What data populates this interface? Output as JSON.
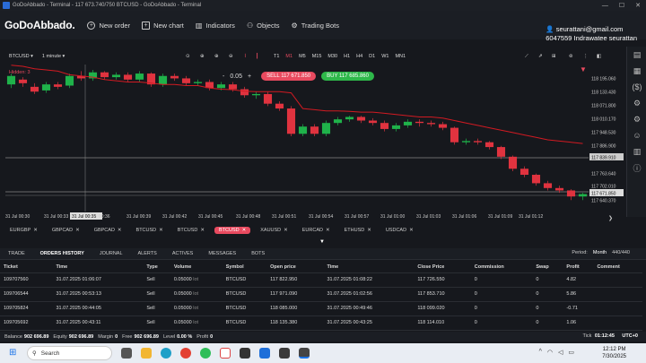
{
  "window": {
    "title": "GoDoAbbado - Terminal - 117 673.740/750 BTCUSD - GoDoAbbado - Terminal",
    "minimize": "—",
    "maximize": "☐",
    "close": "✕"
  },
  "toolbar": {
    "logo": "GoDoAbbado.",
    "new_order": "New order",
    "new_chart": "New chart",
    "indicators": "Indicators",
    "objects": "Objects",
    "trading_bots": "Trading Bots"
  },
  "account": {
    "email": "seurattani@gmail.com",
    "id_name": "6047559 Indrawatee seurattan"
  },
  "chart_toolbar": {
    "symbol": "BTCUSD",
    "timeframe": "1 minute",
    "timeframes": [
      "T1",
      "M1",
      "M5",
      "M15",
      "M30",
      "H1",
      "H4",
      "D1",
      "W1",
      "MN1"
    ],
    "active_tf": "M1"
  },
  "trade_widget": {
    "hidden_label": "Hidden: 3",
    "minus": "-",
    "lot": "0.05",
    "plus": "+",
    "sell_label": "SELL",
    "sell_price": "117 671.850",
    "buy_label": "BUY",
    "buy_price": "117 685.860"
  },
  "price_axis": [
    "118 195.060",
    "118 133.430",
    "118 071.800",
    "118 010.170",
    "117 948.530",
    "117 886.900",
    "117 839.910",
    "117 763.640",
    "117 702.010",
    "117 671.850",
    "117 640.370"
  ],
  "time_axis": [
    "31 Jul 00:30",
    "31 Jul 00:33",
    "31 Jul 00:35",
    "00:36",
    "31 Jul 00:39",
    "31 Jul 00:42",
    "31 Jul 00:45",
    "31 Jul 00:48",
    "31 Jul 00:51",
    "31 Jul 00:54",
    "31 Jul 00:57",
    "31 Jul 01:00",
    "31 Jul 01:03",
    "31 Jul 01:06",
    "31 Jul 01:09",
    "31 Jul 01:12"
  ],
  "symbol_tabs": [
    "EURGBP",
    "GBPCAD",
    "GBPCAD",
    "BTCUSD",
    "BTCUSD",
    "BTCUSD",
    "XAUUSD",
    "EURCAD",
    "ETHUSD",
    "USDCAD"
  ],
  "active_symbol_tab": 5,
  "panel_tabs": [
    "TRADE",
    "ORDERS HISTORY",
    "JOURNAL",
    "ALERTS",
    "ACTIVES",
    "MESSAGES",
    "BOTS"
  ],
  "period": {
    "label": "Period:",
    "value": "Month",
    "count": "440/440"
  },
  "table": {
    "headers": [
      "Ticket",
      "Time",
      "Type",
      "Volume",
      "Symbol",
      "Open price",
      "Time",
      "Close Price",
      "Commission",
      "Swap",
      "Profit",
      "Comment"
    ],
    "rows": [
      [
        "109707560",
        "31.07.2025 01:06:07",
        "Sell",
        "0.05000 lot",
        "BTCUSD",
        "117 822.950",
        "31.07.2025 01:08:22",
        "117 726.550",
        "0",
        "0",
        "4.82",
        ""
      ],
      [
        "109706544",
        "31.07.2025 00:53:13",
        "Sell",
        "0.05000 lot",
        "BTCUSD",
        "117 971.090",
        "31.07.2025 01:02:56",
        "117 853.710",
        "0",
        "0",
        "5.86",
        ""
      ],
      [
        "109705824",
        "31.07.2025 00:44:05",
        "Sell",
        "0.05000 lot",
        "BTCUSD",
        "118 085.000",
        "31.07.2025 00:49:46",
        "118 099.020",
        "0",
        "0",
        "-0.71",
        ""
      ],
      [
        "109705692",
        "31.07.2025 00:43:11",
        "Sell",
        "0.05000 lot",
        "BTCUSD",
        "118 135.380",
        "31.07.2025 00:43:25",
        "118 114.010",
        "0",
        "0",
        "1.06",
        ""
      ]
    ]
  },
  "status": {
    "balance_label": "Balance",
    "balance": "902 696.89",
    "equity_label": "Equity",
    "equity": "902 696.89",
    "margin_label": "Margin",
    "margin": "0",
    "free_label": "Free",
    "free": "902 696.89",
    "level_label": "Level",
    "level": "0.00 %",
    "profit_label": "Profit",
    "profit": "0",
    "tick_label": "Tick",
    "tick": "01:12:45",
    "tz": "UTC+0"
  },
  "taskbar": {
    "search": "Search",
    "time": "12:12 PM",
    "date": "7/30/2025"
  },
  "colors": {
    "bull": "#1fb24a",
    "bear": "#e0333f",
    "ma": "#d11a22",
    "sell_bg": "#e84a5f",
    "buy_bg": "#2eb84a"
  },
  "chart_data": {
    "type": "candlestick",
    "y_range": [
      117620,
      118215
    ],
    "candles": [
      [
        118140,
        118175,
        118125,
        118185
      ],
      [
        118160,
        118145,
        118130,
        118170
      ],
      [
        118130,
        118110,
        118100,
        118145
      ],
      [
        118115,
        118140,
        118105,
        118150
      ],
      [
        118140,
        118130,
        118120,
        118150
      ],
      [
        118135,
        118175,
        118125,
        118185
      ],
      [
        118175,
        118165,
        118155,
        118195
      ],
      [
        118165,
        118190,
        118155,
        118200
      ],
      [
        118190,
        118170,
        118160,
        118195
      ],
      [
        118170,
        118180,
        118160,
        118190
      ],
      [
        118180,
        118160,
        118150,
        118190
      ],
      [
        118160,
        118185,
        118150,
        118195
      ],
      [
        118185,
        118140,
        118130,
        118190
      ],
      [
        118140,
        118175,
        118130,
        118185
      ],
      [
        118175,
        118165,
        118155,
        118185
      ],
      [
        118165,
        118145,
        118135,
        118175
      ],
      [
        118145,
        118150,
        118135,
        118160
      ],
      [
        118150,
        118125,
        118115,
        118160
      ],
      [
        118125,
        118140,
        118115,
        118150
      ],
      [
        118140,
        118120,
        118110,
        118150
      ],
      [
        118120,
        118095,
        118085,
        118130
      ],
      [
        118095,
        118100,
        118080,
        118110
      ],
      [
        118100,
        118060,
        118050,
        118110
      ],
      [
        118060,
        118040,
        118030,
        118070
      ],
      [
        118040,
        117935,
        117925,
        118050
      ],
      [
        117935,
        117965,
        117925,
        117975
      ],
      [
        117965,
        117935,
        117925,
        117975
      ],
      [
        117935,
        117980,
        117925,
        117990
      ],
      [
        117980,
        117995,
        117970,
        118005
      ],
      [
        117995,
        118005,
        117985,
        118010
      ],
      [
        118005,
        117990,
        117980,
        118010
      ],
      [
        117990,
        117980,
        117970,
        118000
      ],
      [
        117980,
        117955,
        117945,
        117990
      ],
      [
        117955,
        117970,
        117945,
        117980
      ],
      [
        117970,
        117985,
        117960,
        117995
      ],
      [
        117985,
        117980,
        117965,
        117995
      ],
      [
        117980,
        117975,
        117965,
        117990
      ],
      [
        117975,
        117960,
        117950,
        117985
      ],
      [
        117960,
        117900,
        117890,
        117965
      ],
      [
        117900,
        117905,
        117890,
        117915
      ],
      [
        117905,
        117900,
        117890,
        117915
      ],
      [
        117900,
        117880,
        117870,
        117905
      ],
      [
        117880,
        117840,
        117830,
        117885
      ],
      [
        117840,
        117790,
        117780,
        117845
      ],
      [
        117790,
        117765,
        117755,
        117800
      ],
      [
        117765,
        117730,
        117720,
        117770
      ],
      [
        117730,
        117710,
        117700,
        117740
      ],
      [
        117710,
        117700,
        117690,
        117720
      ],
      [
        117700,
        117675,
        117660,
        117705
      ],
      [
        117675,
        117685,
        117660,
        117690
      ]
    ],
    "ma": [
      118220,
      118215,
      118205,
      118200,
      118195,
      118180,
      118175,
      118170,
      118160,
      118155,
      118150,
      118150,
      118145,
      118140,
      118140,
      118135,
      118135,
      118125,
      118120,
      118118,
      118112,
      118110,
      118110,
      118110,
      118105,
      118040,
      118035,
      118030,
      118030,
      118028,
      118025,
      118025,
      118020,
      118015,
      118010,
      118005,
      118005,
      118000,
      117990,
      117980,
      117970,
      117960,
      117950,
      117940,
      117930,
      117920,
      117910,
      117905,
      117900,
      117895
    ]
  }
}
